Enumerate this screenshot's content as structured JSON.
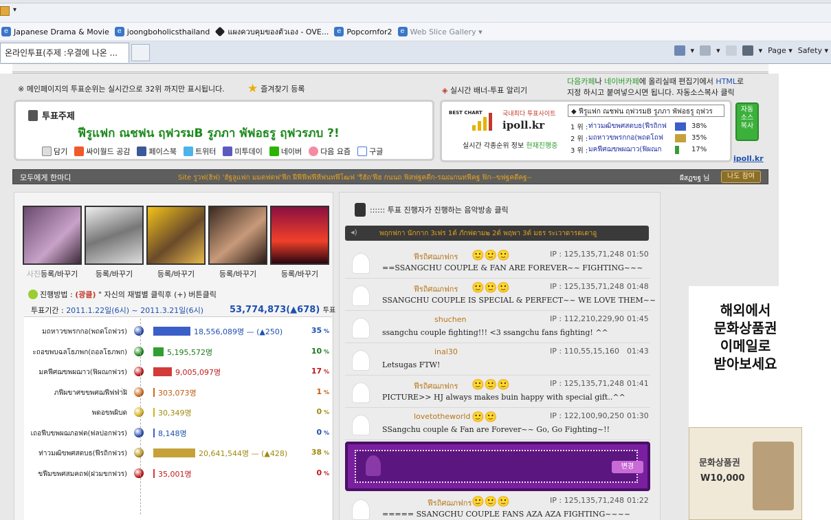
{
  "browser": {
    "favorites": [
      {
        "label": "Japanese Drama & Movie",
        "icon": "ie-page-icon"
      },
      {
        "label": "joongboholicsthailand",
        "icon": "ie-page-icon"
      },
      {
        "label": "แผงควบคุมของตัวเอง - OVE...",
        "icon": "diamond-icon"
      },
      {
        "label": "Popcornfor2",
        "icon": "ie-page-icon"
      },
      {
        "label": "Web Slice Gallery ▾",
        "icon": "ie-page-icon"
      }
    ],
    "active_tab": "온라인투표(주제 :우결에 나온 ...",
    "page_menu": "Page ▾",
    "safety_menu": "Safety ▾"
  },
  "top": {
    "notice": "※ 메인페이지의 투표순위는 실시간으로 32위 까지만 표시됩니다.",
    "fav_add": "즐겨찾기 등록",
    "banner_marker": "◈ ",
    "banner_title": "실시간 배너-투표 알리기",
    "embed_1a": "다음카페",
    "embed_1b": "나 ",
    "embed_1c": "네이버카페",
    "embed_1d": "에 올리실때 편집기에서 ",
    "embed_1e": "HTML",
    "embed_1f": "로",
    "embed_2": "지정 하시고 붙여넣으시면 됩니다.    자동소스복사 클릭"
  },
  "topic": {
    "label": "투표주제",
    "title": "ฟีรูแฟก ณชฟน ฤฟวรมB รูภภา พัฟอธรู ฤฟวรภบ ?!",
    "share": [
      "담기",
      "싸이월드 공감",
      "페이스북",
      "트위터",
      "미투데이",
      "네이버",
      "다음 요즘",
      "구글"
    ]
  },
  "ipoll": {
    "best_chart": "BEST CHART",
    "sub": "국내최다 투표사이트",
    "logo": "ipoll.kr",
    "foot_a": "실시간 각종순위 정보 ",
    "foot_b": "현재진행중",
    "rank_head": "◆ ฟีรูแฟก ณชฟน ฤฟวรมB รูภภา พัฟอธรู ฤฟวร",
    "ranks": [
      {
        "pos": "1 위 :",
        "name": "ท่าวมฒิขพศสตบธ(ฟีรถิกฟ",
        "pct": "38%",
        "color": "#3b5fc8"
      },
      {
        "pos": "2 위 :",
        "name": "มถหาวขพรกกอ(พถดโถฟ",
        "pct": "35%",
        "color": "#c6a13a"
      },
      {
        "pos": "3 위 :",
        "name": "มคฟีศฌขพผฌาว(ฟิผณก",
        "pct": "17%",
        "color": "#3a9a3a"
      }
    ],
    "copy_btn": "자동 소스 복사",
    "link": "ipoll.kr"
  },
  "cheer": {
    "label": "모두에게 한마디",
    "text": "Site รูวฟ(ฮิฟ) 'ฮัฐลูแฟก มมตฟตฟ'ฟีก ฝีฟีฟีฟฟีหีฟนทฟีโฒฟ 'รีฮัถ'ฟีฮ กนนถ ฟิสฟฐคตีก-รฌณกนทฟีคฐ ฟิก--ขฟฐคตีคฐ--",
    "user": "ผีสฏขฐ 님",
    "join": "나도 참여"
  },
  "photos": [
    {
      "caption_a": "사진",
      "caption_b": "등록/바꾸기"
    },
    {
      "caption_a": "",
      "caption_b": "등록/바꾸기"
    },
    {
      "caption_a": "",
      "caption_b": "등록/바꾸기"
    },
    {
      "caption_a": "",
      "caption_b": "등록/바꾸기"
    },
    {
      "caption_a": "",
      "caption_b": "등록/바꾸기"
    }
  ],
  "method": {
    "prefix": "진행방법 : ",
    "highlight": "(광클)",
    "rest": " \" 자신의 재벌별 클릭후 (+) 버튼클릭"
  },
  "period": {
    "label": "투표기간 : ",
    "dates": "2011.1.22일(6시) ~ 2011.3.21일(6시)",
    "total": "53,774,873(▲678)",
    "unit": "투표"
  },
  "votes": [
    {
      "name": "มถหาวขพรกกอ(พถดโถฟวร)",
      "ball": "#2a4fb0",
      "bar": "#3b5fc8",
      "ratio": 0.27,
      "count": "18,556,089명",
      "delta": " — (▲250)",
      "count_color": "#1e4fb0",
      "pct": "35",
      "pct_color": "#1e4fb0"
    },
    {
      "name": "ะถอขพบฉลโธภพก(ถอลโธภพก)",
      "ball": "#1e8a1e",
      "bar": "#2fa02f",
      "ratio": 0.077,
      "count": "5,195,572명",
      "delta": "",
      "count_color": "#1e7a1e",
      "pct": "10",
      "pct_color": "#1e7a1e"
    },
    {
      "name": "มคฟีศฌขพผฌาว(ฟิผณกฟวร)",
      "ball": "#c01a1a",
      "bar": "#d33a3a",
      "ratio": 0.134,
      "count": "9,005,097명",
      "delta": "",
      "count_color": "#c01a1a",
      "pct": "17",
      "pct_color": "#c01a1a"
    },
    {
      "name": "ภฟีผขาศขขพศฌฟีฟฟ่า่ฝิ",
      "ball": "#d06a1a",
      "bar": "#d06a1a",
      "ratio": 0.004,
      "count": "303,073명",
      "delta": "",
      "count_color": "#c05a10",
      "pct": "1",
      "pct_color": "#c05a10"
    },
    {
      "name": "พดอขพผิบด",
      "ball": "#d4b21a",
      "bar": "#d4b21a",
      "ratio": 0.0,
      "count": "30,349명",
      "delta": "",
      "count_color": "#a08a10",
      "pct": "0",
      "pct_color": "#a08a10"
    },
    {
      "name": "เถอฟีบขพผฌภอฟต(ฟลปอกฟวร)",
      "ball": "#2a4fb0",
      "bar": "#3b5fc8",
      "ratio": 0.0,
      "count": "8,148명",
      "delta": "",
      "count_color": "#1e4fb0",
      "pct": "0",
      "pct_color": "#1e4fb0"
    },
    {
      "name": "ท่าวมฒิขพศสตบธ(ฟีรถิกฟวร)",
      "ball": "#b8941a",
      "bar": "#c6a13a",
      "ratio": 0.306,
      "count": "20,641,544명",
      "delta": " — (▲428)",
      "count_color": "#a08a10",
      "pct": "38",
      "pct_color": "#a08a10"
    },
    {
      "name": "ขฟีมขพศสมคถฟ(ฝวมขกฟวร)",
      "ball": "#c01a1a",
      "bar": "#d33a3a",
      "ratio": 0.0,
      "count": "35,001명",
      "delta": "",
      "count_color": "#c01a1a",
      "pct": "0",
      "pct_color": "#c01a1a"
    }
  ],
  "broadcast": {
    "head": "::::::  투표 진행자가 진행하는 음악방송 클릭",
    "ticker": "พฤกฟกา นักกาก 3เฟร 1ต์ ภักฟดาม๒  2ต์ พฤพา  3ต์ มธร  ระเวาดารดเดาอู"
  },
  "comments": [
    {
      "name": "ฟีรถิศฌภฟกร",
      "badges": "🙂🙂🙂",
      "ip": "IP : 125,135,71,248",
      "time": "01:50",
      "msg": "==SSANGCHU COUPLE & FAN ARE FOREVER~~  FIGHTING~~~"
    },
    {
      "name": "ฟีรถิศฌภฟกร",
      "badges": "🙂🙂🙂",
      "ip": "IP : 125,135,71,248",
      "time": "01:48",
      "msg": "SSANGCHU COUPLE IS SPECIAL & PERFECT~~ WE LOVE THEM~~"
    },
    {
      "name": "shuchen",
      "badges": "",
      "ip": "IP : 112,210,229,90",
      "time": "01:45",
      "msg": "ssangchu couple fighting!!! <3 ssangchu fans fighting! ^^"
    },
    {
      "name": "inal30",
      "badges": "",
      "ip": "IP : 110,55,15,160",
      "time": "01:43",
      "msg": "Letsugas FTW!"
    },
    {
      "name": "ฟีรถิศฌภฟกร",
      "badges": "🙂🙂🙂",
      "ip": "IP : 125,135,71,248",
      "time": "01:41",
      "msg": "PICTURE>> HJ always makes buin happy with special gift..^^"
    },
    {
      "name": "lovetotheworld",
      "badges": "🙂🙂",
      "ip": "IP : 122,100,90,250",
      "time": "01:30",
      "msg": "SSangchu couple & Fan are Forever~~ Go, Go Fighting~!!"
    }
  ],
  "change_btn": "변경",
  "last_comment": {
    "name": "ฟีรถิศฌภฟกร",
    "badges": "🙂🙂🙂",
    "ip": "IP : 125,135,71,248",
    "time": "01:22",
    "msg": "=====  SSANGCHU COUPLE FANS   AZA AZA  FIGHTING~~~~"
  },
  "ad": {
    "text_1": "해외에서",
    "text_2": "문화상품권",
    "text_3": "이메일로",
    "text_4": "받아보세요",
    "ticket_label": "문화상품권",
    "ticket_value": "W10,000"
  }
}
